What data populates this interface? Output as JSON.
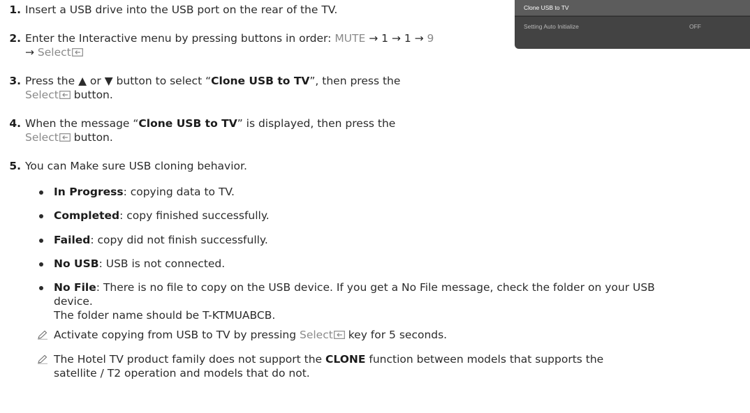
{
  "tv_menu": {
    "items": [
      {
        "label": "Clone USB to TV",
        "value": ""
      },
      {
        "label": "Setting Auto Initialize",
        "value": "OFF"
      }
    ]
  },
  "steps": [
    {
      "num": "1.",
      "text": "Insert a USB drive into the USB port on the rear of the TV."
    },
    {
      "num": "2.",
      "pre": "Enter the Interactive menu by pressing buttons in order: ",
      "key1": "MUTE",
      "arrow1": " → 1 → 1 → ",
      "key2": "9",
      "line2_pre": "→ ",
      "select": "Select"
    },
    {
      "num": "3.",
      "pre": "Press the ▲ or ▼ button to select “",
      "bold": "Clone USB to TV",
      "post": "”, then press the",
      "line2_select": "Select",
      "line2_post": " button."
    },
    {
      "num": "4.",
      "pre": "When the message “",
      "bold": "Clone USB to TV",
      "post": "” is displayed, then press the",
      "line2_select": "Select",
      "line2_post": " button."
    },
    {
      "num": "5.",
      "text": "You can Make sure USB cloning behavior."
    }
  ],
  "bullets": [
    {
      "term": "In Progress",
      "desc": ": copying data to TV."
    },
    {
      "term": "Completed",
      "desc": ": copy finished successfully."
    },
    {
      "term": "Failed",
      "desc": ": copy did not finish successfully."
    },
    {
      "term": "No USB",
      "desc": ": USB is not connected."
    },
    {
      "term": "No File",
      "desc": ": There is no file to copy on the USB device. If you get a No File message, check the folder on your USB",
      "desc_line2": "device.",
      "desc_line3": "The folder name should be T-KTMUABCB."
    }
  ],
  "notes": [
    {
      "pre": "Activate copying from USB to TV by pressing ",
      "select": "Select",
      "post": " key for 5 seconds."
    },
    {
      "pre": "The Hotel TV product family does not support the ",
      "bold": "CLONE",
      "post": " function between models that supports the",
      "line2": "satellite / T2 operation and models that do not."
    }
  ],
  "icons": {
    "select_key": "enter-key-icon",
    "note": "pencil-note-icon"
  },
  "colors": {
    "menu_bg": "#434343",
    "menu_selected": "#5c5c5c",
    "key_text": "#8a8a8a"
  }
}
